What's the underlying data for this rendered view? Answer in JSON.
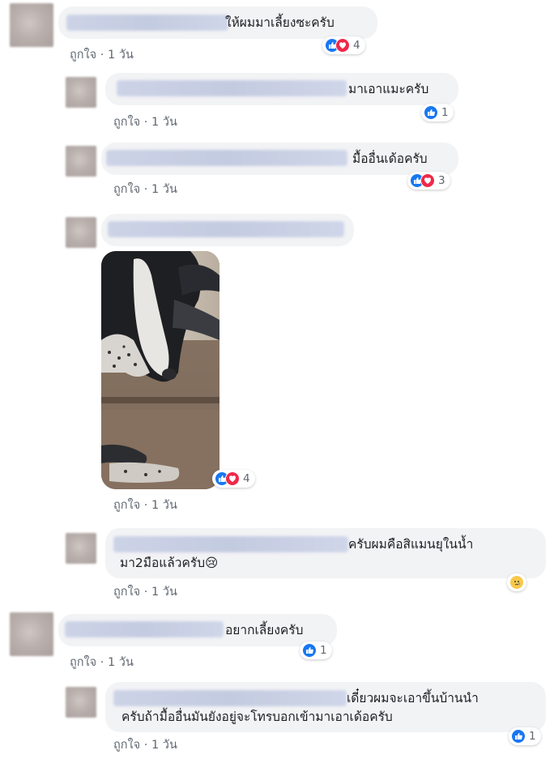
{
  "like_label": "ถูกใจ",
  "separator": "·",
  "comments": [
    {
      "text": "ให้ผมมาเลี้ยงซะครับ",
      "time": "1 วัน",
      "reactions": "4"
    },
    {
      "text": "มาเอาแมะครับ",
      "time": "1 วัน",
      "reactions": "1"
    },
    {
      "text": "มื้ออื่นเด้อครับ",
      "time": "1 วัน",
      "reactions": "3"
    },
    {
      "text": "",
      "time": "1 วัน",
      "reactions": "4"
    },
    {
      "text_line1": "ครับผมคือสิแมนยุในน้ำ",
      "text_line2": "มา2มือแล้วครับ😢",
      "time": "1 วัน"
    },
    {
      "text": "อยากเลี้ยงครับ",
      "time": "1 วัน",
      "reactions": "1"
    },
    {
      "text_line1": "เดี๋ยวผมจะเอาขึ้นบ้านนำ",
      "text_line2": "ครับถ้ามื้ออื่นมันยังอยู่จะโทรบอกเข้ามาเอาเด้อครับ",
      "time": "1 วัน",
      "reactions": "1"
    }
  ],
  "colors": {
    "like": "#1877f2",
    "love": "#f02849",
    "sad": "#f7c84b",
    "bubble": "#f2f3f5",
    "meta": "#606770"
  }
}
